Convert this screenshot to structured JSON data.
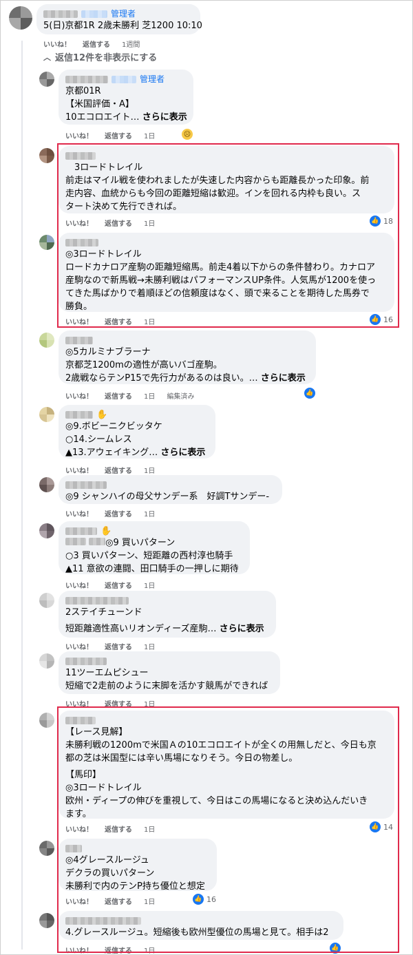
{
  "top_comment": {
    "admin_label": "管理者",
    "text": "5(日)京都1R 2歳未勝利 芝1200 10:10",
    "like": "いいね！",
    "reply": "返信する",
    "time": "1週間"
  },
  "toggle_replies": "返信12件を非表示にする",
  "action_labels": {
    "like": "いいね！",
    "reply": "返信する",
    "edited": "編集済み"
  },
  "replies": [
    {
      "admin_label": "管理者",
      "lines": [
        "京都01R",
        "【米国評価・A】",
        "10エコロエイト… "
      ],
      "more": "さらに表示",
      "time": "1日",
      "reaction": "sad",
      "count": ""
    },
    {
      "lines": [
        "　3ロードトレイル",
        "前走はマイル戦を使われましたが失速した内容からも距離長かった印象。前",
        "走内容、血統からも今回の距離短縮は歓迎。インを回れる内枠も良い。ス",
        "タート決めて先行できれば。"
      ],
      "time": "1日",
      "reaction": "like",
      "count": "18"
    },
    {
      "lines": [
        "◎3ロードトレイル",
        "ロードカナロア産駒の距離短縮馬。前走4着以下からの条件替わり。カナロア",
        "産駒なので新馬戦→未勝利戦はパフォーマンスUP条件。人気馬が1200を使っ",
        "てきた馬ばかりで着順ほどの信頼度はなく、頭で来ることを期待した馬券で",
        "勝負。"
      ],
      "time": "1日",
      "reaction": "like",
      "count": "16"
    },
    {
      "lines": [
        "◎5カルミナブラーナ",
        "京都芝1200mの適性が高いバゴ産駒。",
        "2歳戦ならテンP15で先行力があるのは良い。… "
      ],
      "more": "さらに表示",
      "time": "1日",
      "edited": true,
      "reaction": "like",
      "count": ""
    },
    {
      "lines": [
        "◎9.ボビーニクビッタケ",
        "○14.シームレス",
        "▲13.アウェイキング… "
      ],
      "more": "さらに表示",
      "time": "1日",
      "reaction": "",
      "count": ""
    },
    {
      "lines": [
        "◎9 シャンハイの母父サンデー系　好調Tサンデー-"
      ],
      "time": "1日",
      "reaction": "",
      "count": ""
    },
    {
      "lines": [
        "◎9 買いパターン",
        "○3 買いパターン、短距離の西村淳也騎手",
        "▲11 意欲の連闘、田口騎手の一押しに期待"
      ],
      "time": "1日",
      "reaction": "",
      "count": ""
    },
    {
      "lines": [
        "2ステイチューンド",
        "",
        "短距離適性高いリオンディーズ産駒… "
      ],
      "more": "さらに表示",
      "time": "1日",
      "reaction": "",
      "count": ""
    },
    {
      "lines": [
        "11ツーエムピシュー",
        "短縮で2走前のように末脚を活かす競馬ができれば"
      ],
      "time": "1日",
      "reaction": "",
      "count": ""
    },
    {
      "lines": [
        "【レース見解】",
        "未勝利戦の1200mで米国Ａの10エコロエイトが全くの用無しだと、今日も京",
        "都の芝は米国型には辛い馬場になりそう。今日の物差し。",
        "",
        "【馬印】",
        "◎3ロードトレイル",
        "欧州・ディープの伸びを重視して、今日はこの馬場になると決め込んだいき",
        "ます。"
      ],
      "time": "1日",
      "reaction": "like",
      "count": "14"
    },
    {
      "lines": [
        "◎4グレースルージュ",
        "デクラの買いパターン",
        "未勝利で内のテンP持ち優位と想定"
      ],
      "time": "1日",
      "reaction": "like",
      "count": "16"
    },
    {
      "lines": [
        "4.グレースルージュ。短縮後も欧州型優位の馬場と見て。相手は2"
      ],
      "time": "1日",
      "reaction": "like",
      "count": ""
    }
  ],
  "colors": {
    "accent": "#1877f2",
    "highlight_box": "#e0294b",
    "bubble": "#f0f2f5"
  }
}
